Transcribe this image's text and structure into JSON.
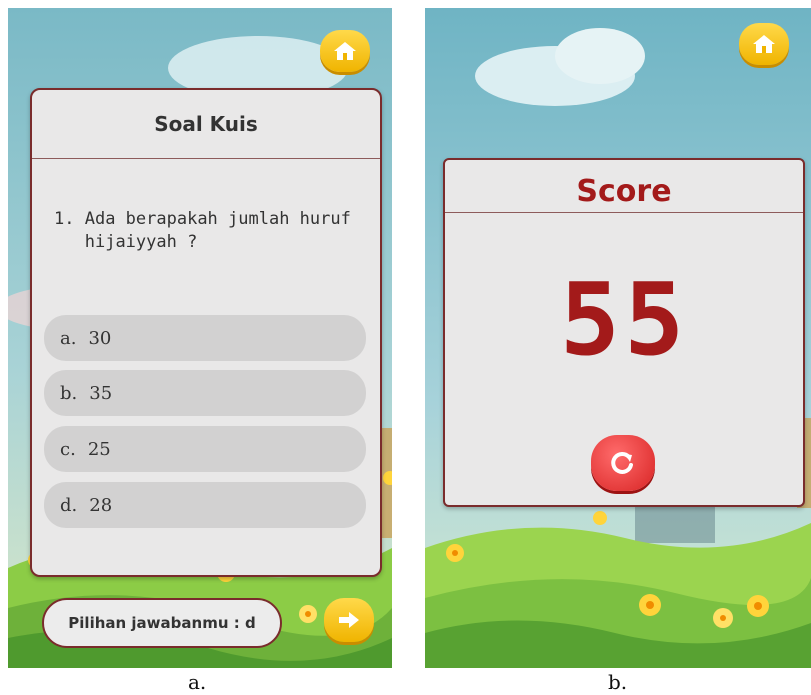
{
  "panel_a": {
    "caption": "a.",
    "quiz": {
      "title": "Soal Kuis",
      "question_number": "1.",
      "question_text": "Ada berapakah jumlah huruf hijaiyyah ?",
      "options": [
        {
          "letter": "a.",
          "text": "30"
        },
        {
          "letter": "b.",
          "text": "35"
        },
        {
          "letter": "c.",
          "text": "25"
        },
        {
          "letter": "d.",
          "text": "28"
        }
      ]
    },
    "answer_label": "Pilihan jawabanmu : d",
    "icons": {
      "home": "home-icon",
      "next": "arrow-right-icon"
    }
  },
  "panel_b": {
    "caption": "b.",
    "score": {
      "title": "Score",
      "value": "55"
    },
    "icons": {
      "home": "home-icon",
      "replay": "replay-icon"
    }
  },
  "colors": {
    "accent_yellow": "#f0b400",
    "score_red": "#a31a1a",
    "card_border": "#7a2c2c",
    "card_bg": "#e9e8e8",
    "sky": "#7fbcc8",
    "grass": "#8ccc46"
  }
}
